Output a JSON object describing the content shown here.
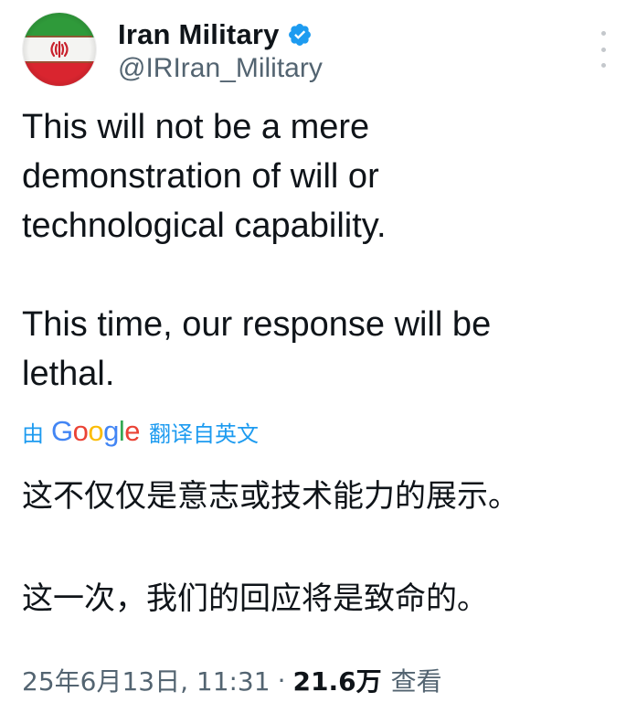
{
  "author": {
    "display_name": "Iran Military",
    "handle": "@IRIran_Military",
    "verified": true,
    "avatar_icon": "iran-flag-avatar"
  },
  "tweet": {
    "text": "This will not be a mere\ndemonstration of will or\ntechnological capability.\n\nThis time, our response will be\nlethal.",
    "translation_prefix": "由",
    "translation_brand": "Google",
    "translation_suffix": "翻译自英文",
    "translated_text": "这不仅仅是意志或技术能力的展示。\n\n这一次，我们的回应将是致命的。"
  },
  "meta": {
    "timestamp": "25年6月13日, 11:31",
    "separator": "·",
    "views_count": "21.6万",
    "views_label": "查看"
  },
  "colors": {
    "text_primary": "#0f1419",
    "text_secondary": "#536471",
    "link_blue": "#1d9bf0",
    "verified_blue": "#1d9bf0"
  }
}
